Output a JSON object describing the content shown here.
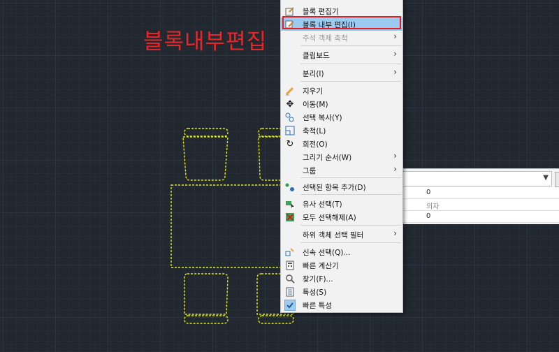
{
  "annotation": "블록내부편집",
  "context_menu": {
    "items": [
      {
        "key": "block_editor",
        "label": "블록 편집기",
        "icon": "block-editor-icon",
        "submenu": false,
        "disabled": false,
        "highlighted": false
      },
      {
        "key": "edit_in_place",
        "label": "블록 내부 편집(I)",
        "icon": "edit-in-place-icon",
        "submenu": false,
        "disabled": false,
        "highlighted": true
      },
      {
        "key": "annotative_scale",
        "label": "주석 객체 축척",
        "icon": "",
        "submenu": true,
        "disabled": true,
        "highlighted": false
      },
      {
        "key": "clipboard",
        "label": "클립보드",
        "icon": "",
        "submenu": true,
        "disabled": false,
        "highlighted": false
      },
      {
        "key": "isolate",
        "label": "분리(I)",
        "icon": "",
        "submenu": true,
        "disabled": false,
        "highlighted": false
      },
      {
        "key": "erase",
        "label": "지우기",
        "icon": "eraser-icon",
        "submenu": false,
        "disabled": false,
        "highlighted": false
      },
      {
        "key": "move",
        "label": "이동(M)",
        "icon": "move-icon",
        "submenu": false,
        "disabled": false,
        "highlighted": false
      },
      {
        "key": "copy_selection",
        "label": "선택 복사(Y)",
        "icon": "copy-icon",
        "submenu": false,
        "disabled": false,
        "highlighted": false
      },
      {
        "key": "scale",
        "label": "축척(L)",
        "icon": "scale-icon",
        "submenu": false,
        "disabled": false,
        "highlighted": false
      },
      {
        "key": "rotate",
        "label": "회전(O)",
        "icon": "rotate-icon",
        "submenu": false,
        "disabled": false,
        "highlighted": false
      },
      {
        "key": "draw_order",
        "label": "그리기 순서(W)",
        "icon": "",
        "submenu": true,
        "disabled": false,
        "highlighted": false
      },
      {
        "key": "group",
        "label": "그룹",
        "icon": "",
        "submenu": true,
        "disabled": false,
        "highlighted": false
      },
      {
        "key": "add_selected",
        "label": "선택된 항목 추가(D)",
        "icon": "add-selected-icon",
        "submenu": false,
        "disabled": false,
        "highlighted": false
      },
      {
        "key": "select_similar",
        "label": "유사 선택(T)",
        "icon": "select-similar-icon",
        "submenu": false,
        "disabled": false,
        "highlighted": false
      },
      {
        "key": "deselect_all",
        "label": "모두 선택해제(A)",
        "icon": "deselect-all-icon",
        "submenu": false,
        "disabled": false,
        "highlighted": false
      },
      {
        "key": "subobject_filter",
        "label": "하위 객체 선택 필터",
        "icon": "",
        "submenu": true,
        "disabled": false,
        "highlighted": false
      },
      {
        "key": "quick_select",
        "label": "신속 선택(Q)...",
        "icon": "quick-select-icon",
        "submenu": false,
        "disabled": false,
        "highlighted": false
      },
      {
        "key": "quickcalc",
        "label": "빠른 계산기",
        "icon": "calculator-icon",
        "submenu": false,
        "disabled": false,
        "highlighted": false
      },
      {
        "key": "find",
        "label": "찾기(F)...",
        "icon": "find-icon",
        "submenu": false,
        "disabled": false,
        "highlighted": false
      },
      {
        "key": "properties",
        "label": "특성(S)",
        "icon": "properties-icon",
        "submenu": false,
        "disabled": false,
        "highlighted": false
      },
      {
        "key": "quick_properties",
        "label": "빠른 특성",
        "icon": "checkmark-icon",
        "submenu": false,
        "disabled": false,
        "highlighted": false
      }
    ]
  },
  "properties_panel": {
    "rows": [
      "0",
      "의자",
      "0"
    ]
  },
  "colors": {
    "drawing_line": "#e6e619",
    "annotation": "#e8262a",
    "highlight": "#9ccbf1",
    "highlight_border": "#e11d26",
    "canvas": "#212830"
  }
}
